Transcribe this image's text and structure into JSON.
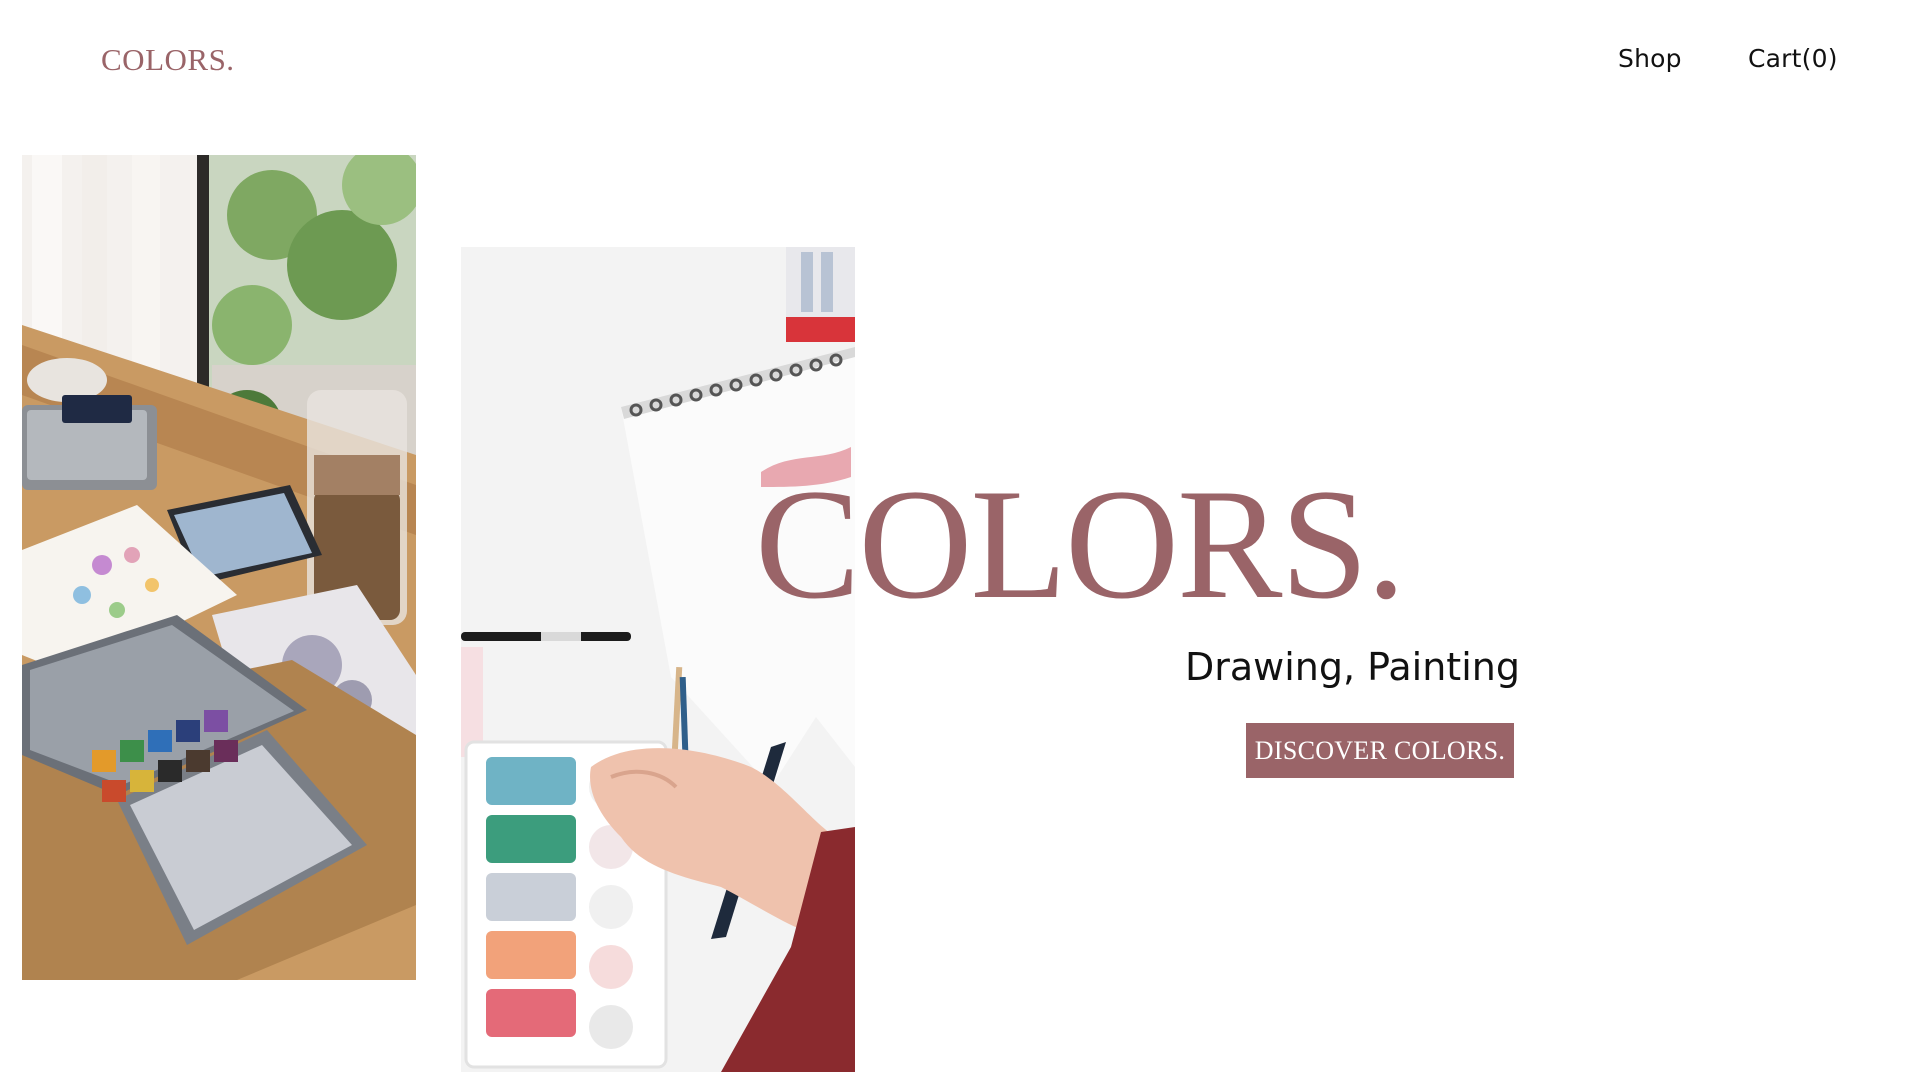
{
  "header": {
    "logo": "COLORS.",
    "nav": {
      "shop_label": "Shop",
      "cart_label": "Cart(0)"
    }
  },
  "hero": {
    "title": "COLORS.",
    "subtitle": "Drawing, Painting",
    "cta_label": "DISCOVER COLORS."
  },
  "colors": {
    "accent": "#9a6468",
    "text": "#111111",
    "background": "#ffffff"
  }
}
